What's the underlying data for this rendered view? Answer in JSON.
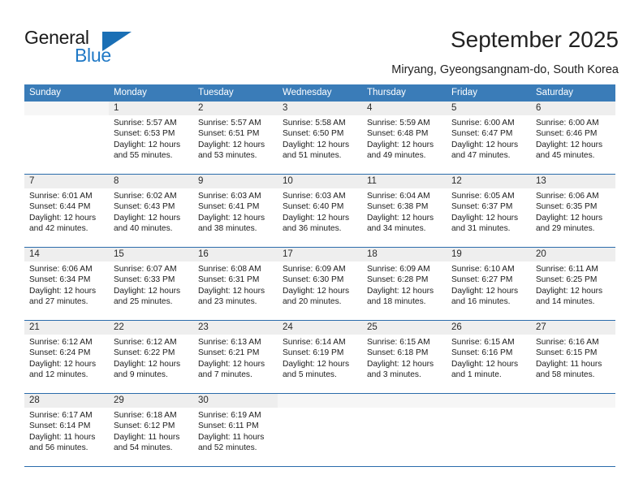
{
  "brand": {
    "line1": "General",
    "line2": "Blue",
    "mark": "triangle-logo"
  },
  "header": {
    "title": "September 2025",
    "location": "Miryang, Gyeongsangnam-do, South Korea"
  },
  "weekdays": [
    "Sunday",
    "Monday",
    "Tuesday",
    "Wednesday",
    "Thursday",
    "Friday",
    "Saturday"
  ],
  "colors": {
    "header_blue": "#3a7cb8",
    "week_divider": "#2b6cab",
    "daynum_bg": "#eeeeee",
    "brand_blue": "#2079c6",
    "logo_blue": "#1a6fb5"
  },
  "weeks": [
    [
      {
        "day": "",
        "blank": true
      },
      {
        "day": "1",
        "sunrise": "Sunrise: 5:57 AM",
        "sunset": "Sunset: 6:53 PM",
        "daylight_1": "Daylight: 12 hours",
        "daylight_2": "and 55 minutes."
      },
      {
        "day": "2",
        "sunrise": "Sunrise: 5:57 AM",
        "sunset": "Sunset: 6:51 PM",
        "daylight_1": "Daylight: 12 hours",
        "daylight_2": "and 53 minutes."
      },
      {
        "day": "3",
        "sunrise": "Sunrise: 5:58 AM",
        "sunset": "Sunset: 6:50 PM",
        "daylight_1": "Daylight: 12 hours",
        "daylight_2": "and 51 minutes."
      },
      {
        "day": "4",
        "sunrise": "Sunrise: 5:59 AM",
        "sunset": "Sunset: 6:48 PM",
        "daylight_1": "Daylight: 12 hours",
        "daylight_2": "and 49 minutes."
      },
      {
        "day": "5",
        "sunrise": "Sunrise: 6:00 AM",
        "sunset": "Sunset: 6:47 PM",
        "daylight_1": "Daylight: 12 hours",
        "daylight_2": "and 47 minutes."
      },
      {
        "day": "6",
        "sunrise": "Sunrise: 6:00 AM",
        "sunset": "Sunset: 6:46 PM",
        "daylight_1": "Daylight: 12 hours",
        "daylight_2": "and 45 minutes."
      }
    ],
    [
      {
        "day": "7",
        "sunrise": "Sunrise: 6:01 AM",
        "sunset": "Sunset: 6:44 PM",
        "daylight_1": "Daylight: 12 hours",
        "daylight_2": "and 42 minutes."
      },
      {
        "day": "8",
        "sunrise": "Sunrise: 6:02 AM",
        "sunset": "Sunset: 6:43 PM",
        "daylight_1": "Daylight: 12 hours",
        "daylight_2": "and 40 minutes."
      },
      {
        "day": "9",
        "sunrise": "Sunrise: 6:03 AM",
        "sunset": "Sunset: 6:41 PM",
        "daylight_1": "Daylight: 12 hours",
        "daylight_2": "and 38 minutes."
      },
      {
        "day": "10",
        "sunrise": "Sunrise: 6:03 AM",
        "sunset": "Sunset: 6:40 PM",
        "daylight_1": "Daylight: 12 hours",
        "daylight_2": "and 36 minutes."
      },
      {
        "day": "11",
        "sunrise": "Sunrise: 6:04 AM",
        "sunset": "Sunset: 6:38 PM",
        "daylight_1": "Daylight: 12 hours",
        "daylight_2": "and 34 minutes."
      },
      {
        "day": "12",
        "sunrise": "Sunrise: 6:05 AM",
        "sunset": "Sunset: 6:37 PM",
        "daylight_1": "Daylight: 12 hours",
        "daylight_2": "and 31 minutes."
      },
      {
        "day": "13",
        "sunrise": "Sunrise: 6:06 AM",
        "sunset": "Sunset: 6:35 PM",
        "daylight_1": "Daylight: 12 hours",
        "daylight_2": "and 29 minutes."
      }
    ],
    [
      {
        "day": "14",
        "sunrise": "Sunrise: 6:06 AM",
        "sunset": "Sunset: 6:34 PM",
        "daylight_1": "Daylight: 12 hours",
        "daylight_2": "and 27 minutes."
      },
      {
        "day": "15",
        "sunrise": "Sunrise: 6:07 AM",
        "sunset": "Sunset: 6:33 PM",
        "daylight_1": "Daylight: 12 hours",
        "daylight_2": "and 25 minutes."
      },
      {
        "day": "16",
        "sunrise": "Sunrise: 6:08 AM",
        "sunset": "Sunset: 6:31 PM",
        "daylight_1": "Daylight: 12 hours",
        "daylight_2": "and 23 minutes."
      },
      {
        "day": "17",
        "sunrise": "Sunrise: 6:09 AM",
        "sunset": "Sunset: 6:30 PM",
        "daylight_1": "Daylight: 12 hours",
        "daylight_2": "and 20 minutes."
      },
      {
        "day": "18",
        "sunrise": "Sunrise: 6:09 AM",
        "sunset": "Sunset: 6:28 PM",
        "daylight_1": "Daylight: 12 hours",
        "daylight_2": "and 18 minutes."
      },
      {
        "day": "19",
        "sunrise": "Sunrise: 6:10 AM",
        "sunset": "Sunset: 6:27 PM",
        "daylight_1": "Daylight: 12 hours",
        "daylight_2": "and 16 minutes."
      },
      {
        "day": "20",
        "sunrise": "Sunrise: 6:11 AM",
        "sunset": "Sunset: 6:25 PM",
        "daylight_1": "Daylight: 12 hours",
        "daylight_2": "and 14 minutes."
      }
    ],
    [
      {
        "day": "21",
        "sunrise": "Sunrise: 6:12 AM",
        "sunset": "Sunset: 6:24 PM",
        "daylight_1": "Daylight: 12 hours",
        "daylight_2": "and 12 minutes."
      },
      {
        "day": "22",
        "sunrise": "Sunrise: 6:12 AM",
        "sunset": "Sunset: 6:22 PM",
        "daylight_1": "Daylight: 12 hours",
        "daylight_2": "and 9 minutes."
      },
      {
        "day": "23",
        "sunrise": "Sunrise: 6:13 AM",
        "sunset": "Sunset: 6:21 PM",
        "daylight_1": "Daylight: 12 hours",
        "daylight_2": "and 7 minutes."
      },
      {
        "day": "24",
        "sunrise": "Sunrise: 6:14 AM",
        "sunset": "Sunset: 6:19 PM",
        "daylight_1": "Daylight: 12 hours",
        "daylight_2": "and 5 minutes."
      },
      {
        "day": "25",
        "sunrise": "Sunrise: 6:15 AM",
        "sunset": "Sunset: 6:18 PM",
        "daylight_1": "Daylight: 12 hours",
        "daylight_2": "and 3 minutes."
      },
      {
        "day": "26",
        "sunrise": "Sunrise: 6:15 AM",
        "sunset": "Sunset: 6:16 PM",
        "daylight_1": "Daylight: 12 hours",
        "daylight_2": "and 1 minute."
      },
      {
        "day": "27",
        "sunrise": "Sunrise: 6:16 AM",
        "sunset": "Sunset: 6:15 PM",
        "daylight_1": "Daylight: 11 hours",
        "daylight_2": "and 58 minutes."
      }
    ],
    [
      {
        "day": "28",
        "sunrise": "Sunrise: 6:17 AM",
        "sunset": "Sunset: 6:14 PM",
        "daylight_1": "Daylight: 11 hours",
        "daylight_2": "and 56 minutes."
      },
      {
        "day": "29",
        "sunrise": "Sunrise: 6:18 AM",
        "sunset": "Sunset: 6:12 PM",
        "daylight_1": "Daylight: 11 hours",
        "daylight_2": "and 54 minutes."
      },
      {
        "day": "30",
        "sunrise": "Sunrise: 6:19 AM",
        "sunset": "Sunset: 6:11 PM",
        "daylight_1": "Daylight: 11 hours",
        "daylight_2": "and 52 minutes."
      },
      {
        "day": "",
        "blank": true
      },
      {
        "day": "",
        "blank": true
      },
      {
        "day": "",
        "blank": true
      },
      {
        "day": "",
        "blank": true
      }
    ]
  ]
}
